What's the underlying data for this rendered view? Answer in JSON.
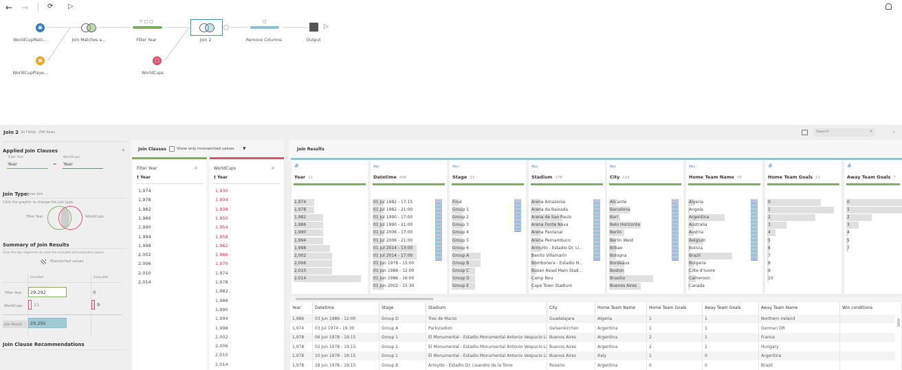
{
  "toolbar": {
    "back": "←",
    "forward": "→",
    "refresh": "⟳",
    "run": "▷",
    "bell": "🔔"
  },
  "flow": {
    "nodes": [
      {
        "id": "worldcupmatches",
        "label": "WorldCupMatc...",
        "color": "#2f7bbf"
      },
      {
        "id": "worldcupplayers",
        "label": "WorldCupPlaye...",
        "color": "#f2a521"
      },
      {
        "id": "join-matches",
        "label": "Join Matches a..."
      },
      {
        "id": "filter-year",
        "label": "Filter Year",
        "color": "#7fae63"
      },
      {
        "id": "join-2",
        "label": "Join 2"
      },
      {
        "id": "worldcups",
        "label": "WorldCups",
        "color": "#d9536f"
      },
      {
        "id": "remove-columns",
        "label": "Remove Columns",
        "color": "#8fc2d3"
      },
      {
        "id": "output",
        "label": "Output"
      }
    ]
  },
  "panel": {
    "title": "Join 2",
    "fields": "34 Fields",
    "rows": "29K Rows",
    "search_placeholder": "Search"
  },
  "left": {
    "applied_title": "Applied Join Clauses",
    "left_source": "Filter Year",
    "right_source": "WorldCups",
    "left_field": "Year",
    "right_field": "Year",
    "eq": "=",
    "join_type_label": "Join Type:",
    "join_type": "Inner Join",
    "join_hint": "Click the graphic to change the join type.",
    "summary_title": "Summary of Join Results",
    "summary_hint": "Click the bar segments to view the included and excluded values.",
    "mismatched": "Mismatched values",
    "included": "Included",
    "excluded": "Excluded",
    "row_filter": "Filter Year",
    "row_worldcups": "WorldCups",
    "row_result": "Join Result",
    "filter_included": "29,292",
    "filter_excluded": "0",
    "wc_included": "11",
    "wc_excluded": "9",
    "result_included": "29,292",
    "recommend_title": "Join Clause Recommendations"
  },
  "clauses": {
    "title": "Join Clauses",
    "mismatch_label": "Show only mismatched values",
    "left": {
      "source": "Filter Year",
      "field": "† Year",
      "values": [
        "1,974",
        "1,978",
        "1,982",
        "1,986",
        "1,990",
        "1,994",
        "1,998",
        "2,002",
        "2,006",
        "2,010",
        "2,014"
      ]
    },
    "right": {
      "source": "WorldCups",
      "field": "† Year",
      "values": [
        {
          "v": "1,930",
          "m": true
        },
        {
          "v": "1,934",
          "m": true
        },
        {
          "v": "1,938",
          "m": true
        },
        {
          "v": "1,950",
          "m": true
        },
        {
          "v": "1,954",
          "m": true
        },
        {
          "v": "1,958",
          "m": true
        },
        {
          "v": "1,962",
          "m": true
        },
        {
          "v": "1,966",
          "m": true
        },
        {
          "v": "1,970",
          "m": true
        },
        {
          "v": "1,974",
          "m": false
        },
        {
          "v": "1,978",
          "m": false
        },
        {
          "v": "1,982",
          "m": false
        },
        {
          "v": "1,986",
          "m": false
        },
        {
          "v": "1,990",
          "m": false
        },
        {
          "v": "1,994",
          "m": false
        },
        {
          "v": "1,998",
          "m": false
        },
        {
          "v": "2,002",
          "m": false
        },
        {
          "v": "2,006",
          "m": false
        },
        {
          "v": "2,010",
          "m": false
        },
        {
          "v": "2,014",
          "m": false
        }
      ]
    }
  },
  "results": {
    "title": "Join Results",
    "profiles": [
      {
        "type": "#",
        "name": "Year",
        "count": "11",
        "mini": false,
        "items": [
          [
            "1,974",
            0.3
          ],
          [
            "1,978",
            0.3
          ],
          [
            "1,982",
            0.43
          ],
          [
            "1,986",
            0.43
          ],
          [
            "1,990",
            0.43
          ],
          [
            "1,994",
            0.43
          ],
          [
            "1,998",
            0.53
          ],
          [
            "2,002",
            0.56
          ],
          [
            "2,006",
            0.56
          ],
          [
            "2,010",
            0.56
          ],
          [
            "2,014",
            0.98
          ]
        ]
      },
      {
        "type": "Abc",
        "name": "Datetime",
        "count": "496",
        "mini": true,
        "items": [
          [
            "01 Jul 1982 - 17:15",
            0.2
          ],
          [
            "01 Jul 1982 - 21:00",
            0.2
          ],
          [
            "01 Jul 1990 - 17:00",
            0.2
          ],
          [
            "01 Jul 1990 - 21:00",
            0.2
          ],
          [
            "01 Jul 2006 - 17:00",
            0.2
          ],
          [
            "01 Jul 2006 - 21:00",
            0.2
          ],
          [
            "01 Jul 2014 - 13:00",
            0.8
          ],
          [
            "01 Jul 2014 - 17:00",
            0.8
          ],
          [
            "01 Jun 1978 - 15:00",
            0.2
          ],
          [
            "01 Jun 1986 - 12:00",
            0.2
          ],
          [
            "01 Jun 1986 - 16:00",
            0.2
          ],
          [
            "01 Jun 2002 - 15:30",
            0.2
          ]
        ]
      },
      {
        "type": "Abc",
        "name": "Stage",
        "count": "21",
        "mini": true,
        "items": [
          [
            "Final",
            0.12
          ],
          [
            "Group 1",
            0.2
          ],
          [
            "Group 2",
            0.2
          ],
          [
            "Group 3",
            0.2
          ],
          [
            "Group 4",
            0.2
          ],
          [
            "Group 5",
            0.2
          ],
          [
            "Group 6",
            0.2
          ],
          [
            "Group A",
            0.53
          ],
          [
            "Group B",
            0.53
          ],
          [
            "Group C",
            0.43
          ],
          [
            "Group D",
            0.43
          ],
          [
            "Group E",
            0.43
          ]
        ]
      },
      {
        "type": "Abc",
        "name": "Stadium",
        "count": "178",
        "mini": true,
        "items": [
          [
            "Arena Amazonia",
            0.18
          ],
          [
            "Arena da Baixada",
            0.18
          ],
          [
            "Arena de Sao Paulo",
            0.58
          ],
          [
            "Arena Fonte Nova",
            0.58
          ],
          [
            "Arena Pantanal",
            0.18
          ],
          [
            "Arena Pernambuco",
            0.18
          ],
          [
            "Arroyito - Estadio Dr. Li...",
            0.18
          ],
          [
            "Benito Villamarin",
            0.05
          ],
          [
            "Bombonera - Estadio N...",
            0.1
          ],
          [
            "Busan Asiad Main Stad...",
            0.1
          ],
          [
            "Camp Nou",
            0.05
          ],
          [
            "Cape Town Stadium",
            0.05
          ]
        ]
      },
      {
        "type": "Abc",
        "name": "City",
        "count": "114",
        "mini": true,
        "items": [
          [
            "Alicante",
            0.13
          ],
          [
            "Barcelona",
            0.38
          ],
          [
            "Bari",
            0.2
          ],
          [
            "Belo Horizonte",
            0.58
          ],
          [
            "Berlin",
            0.27
          ],
          [
            "Berlin West",
            0.13
          ],
          [
            "Bilbao",
            0.13
          ],
          [
            "Bologna",
            0.13
          ],
          [
            "Bordeaux",
            0.27
          ],
          [
            "Boston",
            0.27
          ],
          [
            "Brasilia",
            0.8
          ],
          [
            "Buenos Aires",
            0.58
          ]
        ]
      },
      {
        "type": "Abc",
        "name": "Home Team Name",
        "count": "76",
        "mini": true,
        "items": [
          [
            "Algeria",
            0.1
          ],
          [
            "Angola",
            0.03
          ],
          [
            "Argentina",
            0.66
          ],
          [
            "Australia",
            0.1
          ],
          [
            "Austria",
            0.1
          ],
          [
            "Belgium",
            0.27
          ],
          [
            "Bolivia",
            0.03
          ],
          [
            "Brazil",
            0.8
          ],
          [
            "Bulgaria",
            0.1
          ],
          [
            "Côte d'Ivoire",
            0.05
          ],
          [
            "Cameroon",
            0.14
          ],
          [
            "Canada",
            0.03
          ]
        ]
      },
      {
        "type": "#",
        "name": "Home Team Goals",
        "count": "11",
        "mini": false,
        "items": [
          [
            "0",
            0.78
          ],
          [
            "1",
            0.97
          ],
          [
            "2",
            0.7
          ],
          [
            "3",
            0.28
          ],
          [
            "4",
            0.12
          ],
          [
            "5",
            0.04
          ],
          [
            "6",
            0.04
          ],
          [
            "7",
            0.02
          ],
          [
            "8",
            0.02
          ],
          [
            "9",
            0.02
          ],
          [
            "10",
            0.02
          ]
        ]
      },
      {
        "type": "#",
        "name": "Away Team Goals",
        "count": "7",
        "mini": false,
        "items": [
          [
            "0",
            1.0
          ],
          [
            "1",
            1.0
          ],
          [
            "2",
            0.37
          ],
          [
            "3",
            0.18
          ],
          [
            "4",
            0.03
          ],
          [
            "5",
            0.03
          ],
          [
            "7",
            0.03
          ]
        ]
      }
    ],
    "columns": [
      "Year",
      "Datetime",
      "Stage",
      "Stadium",
      "City",
      "Home Team Name",
      "Home Team Goals",
      "Away Team Goals",
      "Away Team Name",
      "Win conditions"
    ],
    "rows": [
      [
        "1,986",
        "03 Jun 1986 - 12:00",
        "Group D",
        "Tres de Marzo",
        "Guadalajara",
        "Algeria",
        "1",
        "1",
        "Northern Ireland",
        ""
      ],
      [
        "1,974",
        "03 Jul 1974 - 19:30",
        "Group A",
        "Parkstadion",
        "Gelsenkirchen",
        "Argentina",
        "1",
        "1",
        "German DR",
        ""
      ],
      [
        "1,978",
        "06 Jun 1978 - 19:15",
        "Group 1",
        "El Monumental - Estadio Monumental Antonio Vespucio Liberti",
        "Buenos Aires",
        "Argentina",
        "2",
        "1",
        "France",
        ""
      ],
      [
        "1,978",
        "02 Jun 1978 - 19:15",
        "Group 1",
        "El Monumental - Estadio Monumental Antonio Vespucio Liberti",
        "Buenos Aires",
        "Argentina",
        "2",
        "1",
        "Hungary",
        ""
      ],
      [
        "1,978",
        "10 Jun 1978 - 19:15",
        "Group 1",
        "El Monumental - Estadio Monumental Antonio Vespucio Liberti",
        "Buenos Aires",
        "Italy",
        "1",
        "0",
        "Argentina",
        ""
      ],
      [
        "1,978",
        "18 Jun 1978 - 19:15",
        "Group B",
        "Arroyito - Estadio Dr. Lisandro de la Torre",
        "Rosario",
        "Argentina",
        "0",
        "0",
        "Brazil",
        ""
      ]
    ]
  }
}
